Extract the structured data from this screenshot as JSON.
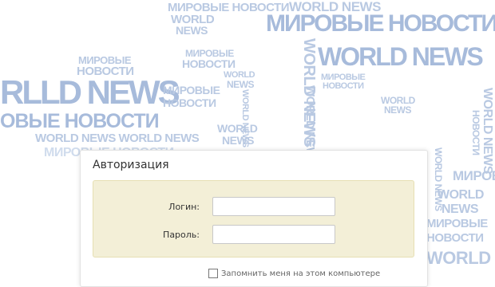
{
  "background": {
    "words": {
      "world_news": "WORLD NEWS",
      "world": "WORLD",
      "news": "NEWS",
      "rlld_news": "RLLD NEWS",
      "novosti_mirovye": "МИРОВЫЕ НОВОСТИ",
      "mirovye": "МИРОВЫЕ",
      "novosti": "НОВОСТИ",
      "obye_novosti": "ОВЫЕ НОВОСТИ",
      "world_news_world_news": "WORLD NEWS WORLD NEWS",
      "mirovye_novosti_short": "МИРОВЫЕ НОВОСТИ"
    },
    "color": "#b9c9e2"
  },
  "dialog": {
    "title": "Авторизация",
    "login_label": "Логин:",
    "password_label": "Пароль:",
    "login_value": "",
    "password_value": "",
    "remember_label": "Запомнить меня на этом компьютере"
  }
}
